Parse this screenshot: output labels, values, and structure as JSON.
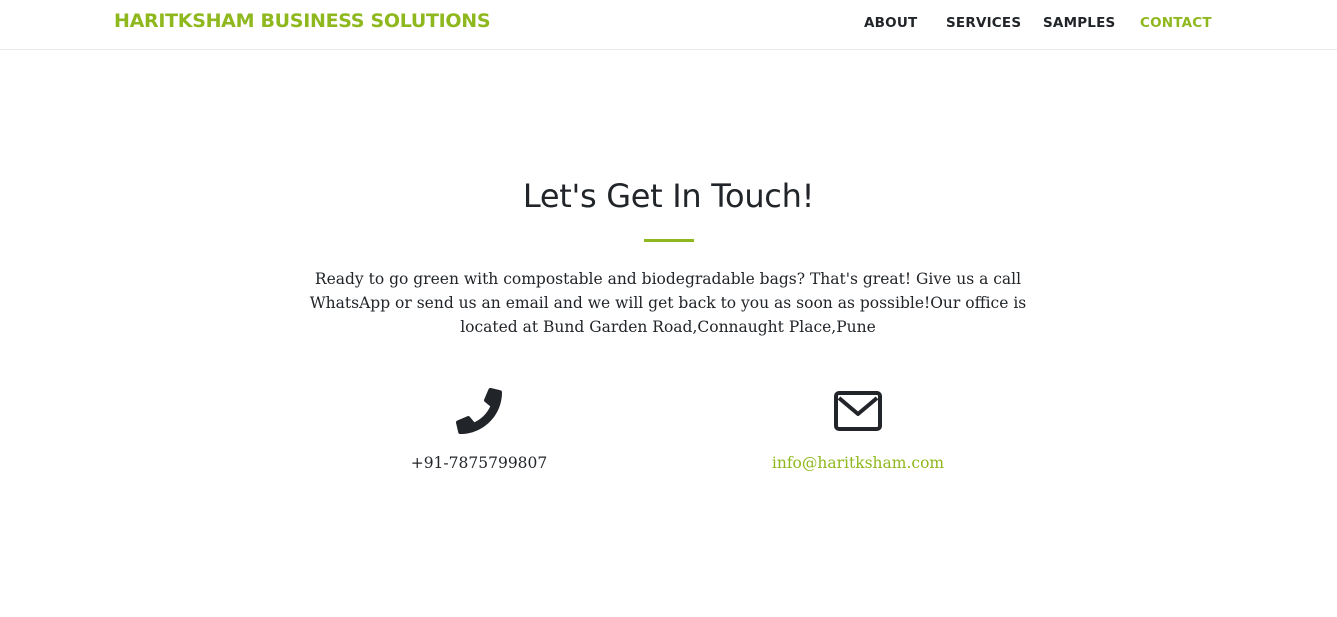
{
  "brand": {
    "name": "HARITKSHAM BUSINESS SOLUTIONS"
  },
  "nav": {
    "items": [
      {
        "label": "ABOUT"
      },
      {
        "label": "SERVICES"
      },
      {
        "label": "SAMPLES"
      },
      {
        "label": "CONTACT"
      }
    ],
    "active": "CONTACT"
  },
  "contact": {
    "heading": "Let's Get In Touch!",
    "description": "Ready to go green with compostable and biodegradable bags? That's great! Give us a call WhatsApp or send us an email and we will get back to you as soon as possible!Our office is located at Bund Garden Road,Connaught Place,Pune",
    "phone": {
      "icon": "phone-icon",
      "number": "+91-7875799807"
    },
    "email": {
      "icon": "envelope-icon",
      "address": "info@haritksham.com"
    }
  },
  "colors": {
    "accent": "#8fb81e",
    "text": "#212529",
    "background": "#ffffff"
  }
}
